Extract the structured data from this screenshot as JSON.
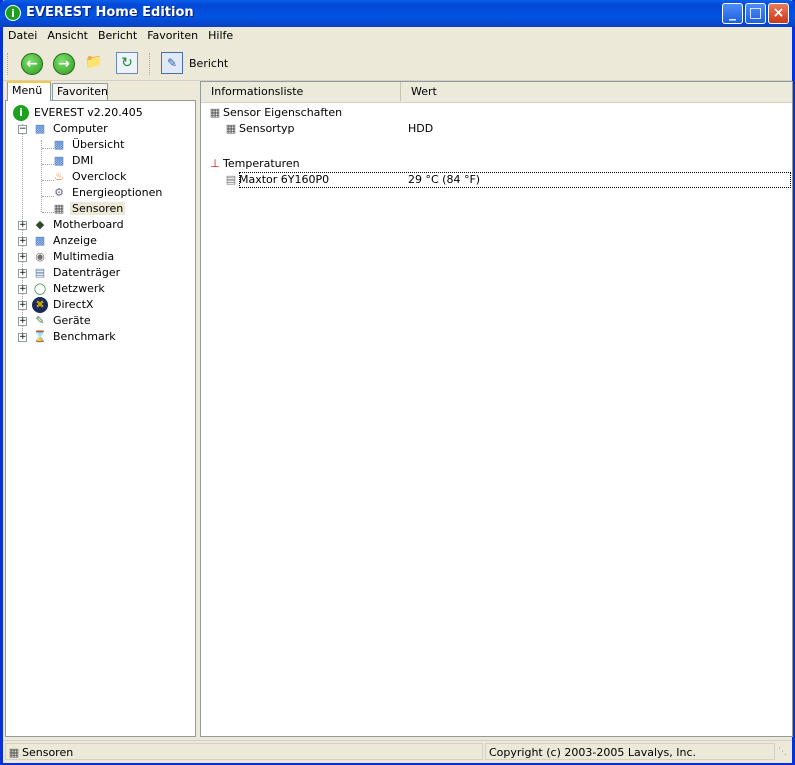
{
  "window": {
    "title": "EVEREST Home Edition"
  },
  "menubar": [
    "Datei",
    "Ansicht",
    "Bericht",
    "Favoriten",
    "Hilfe"
  ],
  "toolbar": {
    "report_label": "Bericht"
  },
  "tabs": [
    "Menü",
    "Favoriten"
  ],
  "tree": {
    "root": "EVEREST v2.20.405",
    "computer": "Computer",
    "children": [
      "Übersicht",
      "DMI",
      "Overclock",
      "Energieoptionen",
      "Sensoren"
    ],
    "selected": "Sensoren",
    "groups": [
      "Motherboard",
      "Anzeige",
      "Multimedia",
      "Datenträger",
      "Netzwerk",
      "DirectX",
      "Geräte",
      "Benchmark"
    ]
  },
  "list": {
    "columns": [
      "Informationsliste",
      "Wert"
    ],
    "section1": "Sensor Eigenschaften",
    "sensor_type_label": "Sensortyp",
    "sensor_type_value": "HDD",
    "section2": "Temperaturen",
    "drive_label": "Maxtor 6Y160P0",
    "drive_value": "29 °C  (84 °F)"
  },
  "status": {
    "left": "Sensoren",
    "right": "Copyright (c) 2003-2005 Lavalys, Inc."
  }
}
